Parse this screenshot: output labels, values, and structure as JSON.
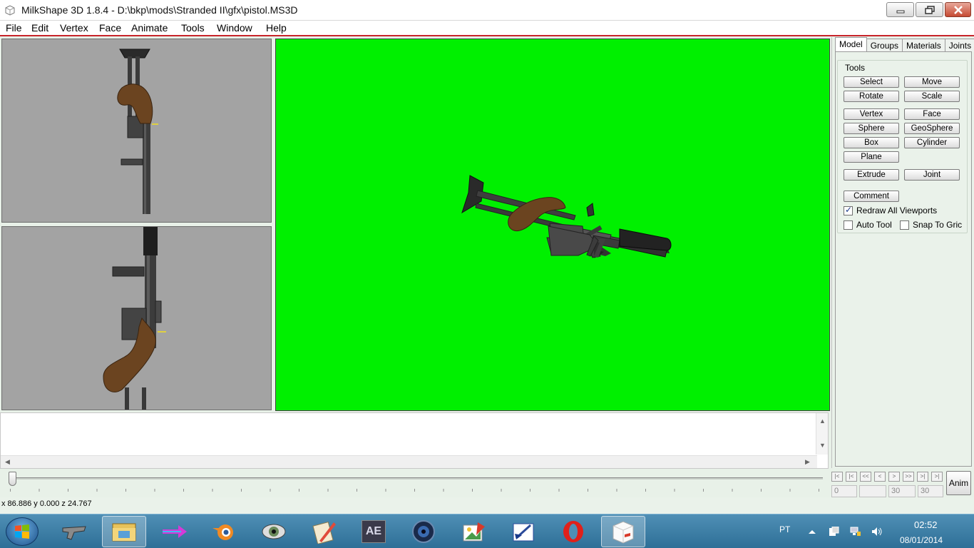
{
  "window": {
    "title": "MilkShape 3D 1.8.4 - D:\\bkp\\mods\\Stranded II\\gfx\\pistol.MS3D"
  },
  "menu": [
    "File",
    "Edit",
    "Vertex",
    "Face",
    "Animate",
    "Tools",
    "Window",
    "Help"
  ],
  "tabs": [
    "Model",
    "Groups",
    "Materials",
    "Joints"
  ],
  "active_tab": "Model",
  "tools": {
    "label": "Tools",
    "select": "Select",
    "move": "Move",
    "rotate": "Rotate",
    "scale": "Scale",
    "vertex": "Vertex",
    "face": "Face",
    "sphere": "Sphere",
    "geosphere": "GeoSphere",
    "box": "Box",
    "cylinder": "Cylinder",
    "plane": "Plane",
    "extrude": "Extrude",
    "joint": "Joint",
    "comment": "Comment"
  },
  "options": {
    "redraw": {
      "label": "Redraw All Viewports",
      "checked": true
    },
    "auto_tool": {
      "label": "Auto Tool",
      "checked": false
    },
    "snap": {
      "label": "Snap To Gric",
      "checked": false
    }
  },
  "animation": {
    "frame_start": "0",
    "frame_current": "",
    "frame_end": "30",
    "frame_total": "30",
    "anim_label": "Anim"
  },
  "status": {
    "coords": "x 86.886 y 0.000 z 24.767"
  },
  "colors": {
    "viewport_3d": "#00f000",
    "viewport_2d": "#a3a3a3",
    "grip": "#6b4420"
  },
  "taskbar": {
    "apps": [
      "crossfire",
      "file-explorer",
      "colorful-arrow",
      "blender",
      "eye-app",
      "notepad-pencil",
      "after-effects",
      "camera-lens",
      "image-editor",
      "paint-app",
      "opera",
      "milkshape"
    ],
    "ae_label": "AE",
    "lang": "PT",
    "time": "02:52",
    "date": "08/01/2014"
  }
}
